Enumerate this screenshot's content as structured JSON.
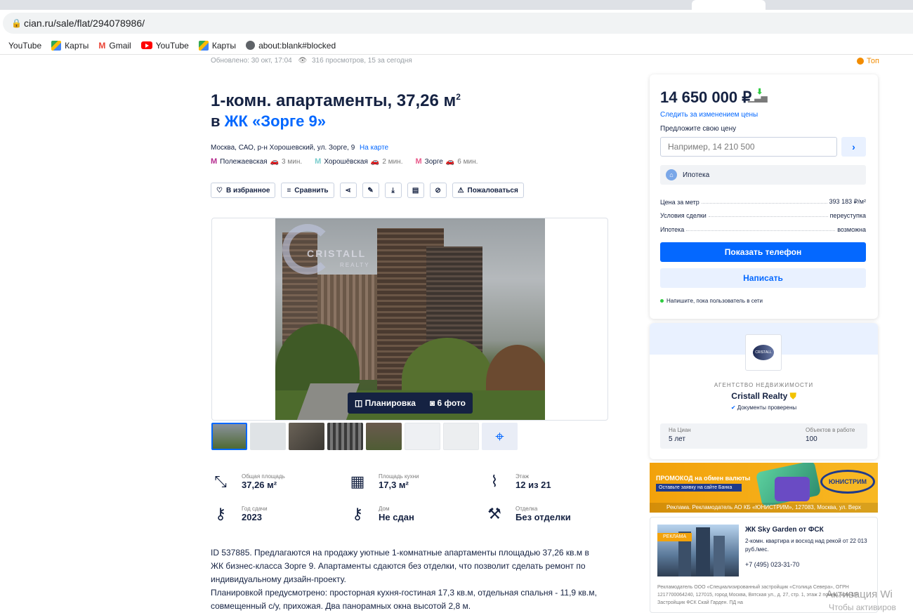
{
  "browser": {
    "url": "cian.ru/sale/flat/294078986/",
    "bookmarks": [
      {
        "label": "YouTube",
        "icon": "none"
      },
      {
        "label": "Карты",
        "icon": "maps-icon"
      },
      {
        "label": "Gmail",
        "icon": "gmail-icon"
      },
      {
        "label": "YouTube",
        "icon": "youtube-icon"
      },
      {
        "label": "Карты",
        "icon": "maps-icon"
      },
      {
        "label": "about:blank#blocked",
        "icon": "globe-icon"
      }
    ]
  },
  "listing": {
    "updated": "Обновлено: 30 окт, 17:04",
    "views": "316 просмотров, 15 за сегодня",
    "top_badge": "Топ",
    "title": "1-комн. апартаменты, 37,26 м",
    "title_sup": "2",
    "subtitle_prefix": "в",
    "complex": "ЖК «Зорге 9»",
    "address": "Москва, САО, р-н Хорошевский, ул. Зорге, 9",
    "map_link": "На карте",
    "metro": [
      {
        "name": "Полежаевская",
        "time": "3 мин.",
        "color": "#b52b8f"
      },
      {
        "name": "Хорошёвская",
        "time": "2 мин.",
        "color": "#79cdcd"
      },
      {
        "name": "Зорге",
        "time": "6 мин.",
        "color": "#e8598a"
      }
    ],
    "actions": {
      "favorite": "В избранное",
      "compare": "Сравнить",
      "report": "Пожаловаться"
    },
    "photo": {
      "watermark": "CRISTALL",
      "watermark_sub": "REALTY",
      "plan_label": "Планировка",
      "photos_label": "6 фото"
    },
    "features": [
      {
        "label": "Общая площадь",
        "value": "37,26 м²",
        "icon": "area-icon"
      },
      {
        "label": "Площадь кухни",
        "value": "17,3 м²",
        "icon": "kitchen-icon"
      },
      {
        "label": "Этаж",
        "value": "12 из 21",
        "icon": "stairs-icon"
      },
      {
        "label": "Год сдачи",
        "value": "2023",
        "icon": "key-icon"
      },
      {
        "label": "Дом",
        "value": "Не сдан",
        "icon": "house-key-icon"
      },
      {
        "label": "Отделка",
        "value": "Без отделки",
        "icon": "tools-icon"
      }
    ],
    "description": [
      "ID 537885. Предлагаются на продажу уютные 1-комнатные апартаменты площадью 37,26 кв.м в ЖК бизнес-класса Зорге 9. Апартаменты сдаются без отделки, что позволит сделать ремонт по индивидуальному дизайн-проекту.",
      "Планировкой предусмотрено: просторная кухня-гостиная 17,3 кв.м, отдельная спальня - 11,9 кв.м, совмещенный с/у, прихожая. Два панорамных окна высотой 2,8 м."
    ]
  },
  "price_card": {
    "price": "14 650 000 ₽",
    "follow": "Следить за изменением цены",
    "offer_label": "Предложите свою цену",
    "offer_placeholder": "Например, 14 210 500",
    "mortgage": "Ипотека",
    "rows": [
      {
        "k": "Цена за метр",
        "v": "393 183 ₽/м²"
      },
      {
        "k": "Условия сделки",
        "v": "переуступка"
      },
      {
        "k": "Ипотека",
        "v": "возможна"
      }
    ],
    "show_phone": "Показать телефон",
    "write": "Написать",
    "online_hint": "Напишите, пока пользователь в сети"
  },
  "agent": {
    "logo_text": "CRISTALL",
    "type": "АГЕНТСТВО НЕДВИЖИМОСТИ",
    "name": "Cristall Realty",
    "verified": "Документы проверены",
    "stat1_label": "На Циан",
    "stat1_value": "5 лет",
    "stat2_label": "Объектов в работе",
    "stat2_value": "100"
  },
  "promo": {
    "headline": "ПРОМОКОД на обмен валюты",
    "button": "Оставьте заявку на сайте Банка",
    "logo": "ЮНИСТРИМ",
    "legal": "Реклама. Рекламодатель АО КБ «ЮНИСТРИМ», 127083, Москва, ул. Верх"
  },
  "ad": {
    "tag": "РЕКЛАМА",
    "title": "ЖК Sky Garden от ФСК",
    "text": "2-комн. квартира и восход над рекой от 22 013 руб./мес.",
    "phone": "+7 (495) 023-31-70",
    "legal": "Рекламодатель ООО «Специализированный застройщик «Столица Севера», ОГРН 1217700064240, 127015, город Москва, Вятская ул., д. 27, стр. 1, этаж 2 помещ./ком 1/9. Застройщик ФСК Скай Гарден. ПД на"
  },
  "windows": {
    "activation": "Активация Wi",
    "activation2": "Чтобы активиров"
  }
}
